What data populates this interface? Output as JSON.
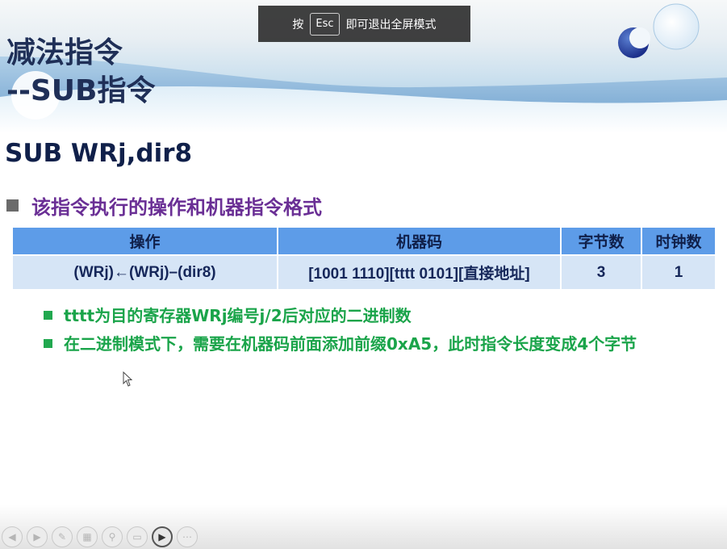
{
  "esc_banner": {
    "prefix": "按",
    "key": "Esc",
    "suffix": "即可退出全屏模式"
  },
  "slide": {
    "title_line1": "减法指令",
    "title_line2": "--SUB指令",
    "instruction": "SUB WRj,dir8",
    "section_heading": "该指令执行的操作和机器指令格式",
    "table": {
      "headers": [
        "操作",
        "机器码",
        "字节数",
        "时钟数"
      ],
      "rows": [
        [
          "(WRj)←(WRj)–(dir8)",
          "[1001 1110][tttt 0101][直接地址]",
          "3",
          "1"
        ]
      ]
    },
    "notes": [
      "tttt为目的寄存器WRj编号j/2后对应的二进制数",
      "在二进制模式下，需要在机器码前面添加前缀0xA5，此时指令长度变成4个字节"
    ]
  },
  "colors": {
    "title": "#1f2f57",
    "heading": "#6a2f95",
    "note_text": "#1aa44a",
    "table_header_bg": "#5d9ce8",
    "table_row_bg": "#d6e5f6"
  },
  "toolbar": {
    "buttons": [
      {
        "name": "previous-icon",
        "glyph": "◀"
      },
      {
        "name": "next-icon",
        "glyph": "▶"
      },
      {
        "name": "pen-icon",
        "glyph": "✎"
      },
      {
        "name": "slides-icon",
        "glyph": "▦"
      },
      {
        "name": "zoom-icon",
        "glyph": "⚲"
      },
      {
        "name": "screen-icon",
        "glyph": "▭"
      },
      {
        "name": "video-icon",
        "glyph": "▶"
      },
      {
        "name": "more-icon",
        "glyph": "⋯"
      }
    ]
  }
}
